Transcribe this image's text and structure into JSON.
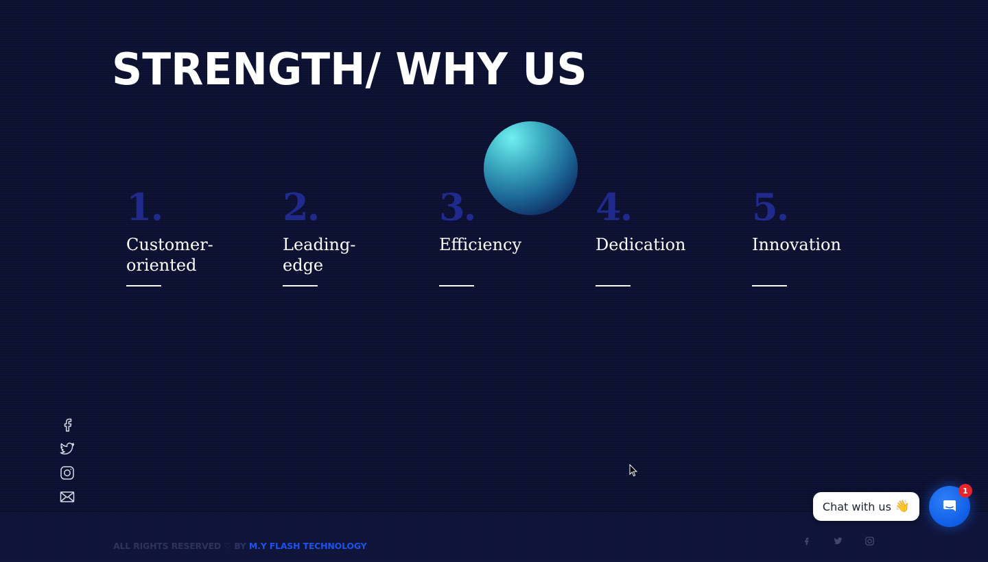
{
  "section": {
    "title": "STRENGTH/ WHY US"
  },
  "strengths": [
    {
      "number": "1.",
      "label": "Customer-\noriented"
    },
    {
      "number": "2.",
      "label": "Leading-\nedge"
    },
    {
      "number": "3.",
      "label": "Efficiency"
    },
    {
      "number": "4.",
      "label": "Dedication"
    },
    {
      "number": "5.",
      "label": "Innovation"
    }
  ],
  "social_left": [
    "facebook-icon",
    "twitter-icon",
    "instagram-icon",
    "mail-icon"
  ],
  "footer": {
    "copyright_prefix": "ALL RIGHTS RESERVED ♡ BY ",
    "brand": "M.Y FLASH TECHNOLOGY",
    "social": [
      "facebook-icon",
      "twitter-icon",
      "instagram-icon"
    ]
  },
  "chat": {
    "label": "Chat with us",
    "emoji": "👋",
    "badge_count": "1"
  },
  "colors": {
    "background": "#0c1133",
    "number_color": "#1f2a8c",
    "brand_blue": "#1c54e8",
    "chat_button": "#1462e8",
    "badge": "#e5252a"
  }
}
